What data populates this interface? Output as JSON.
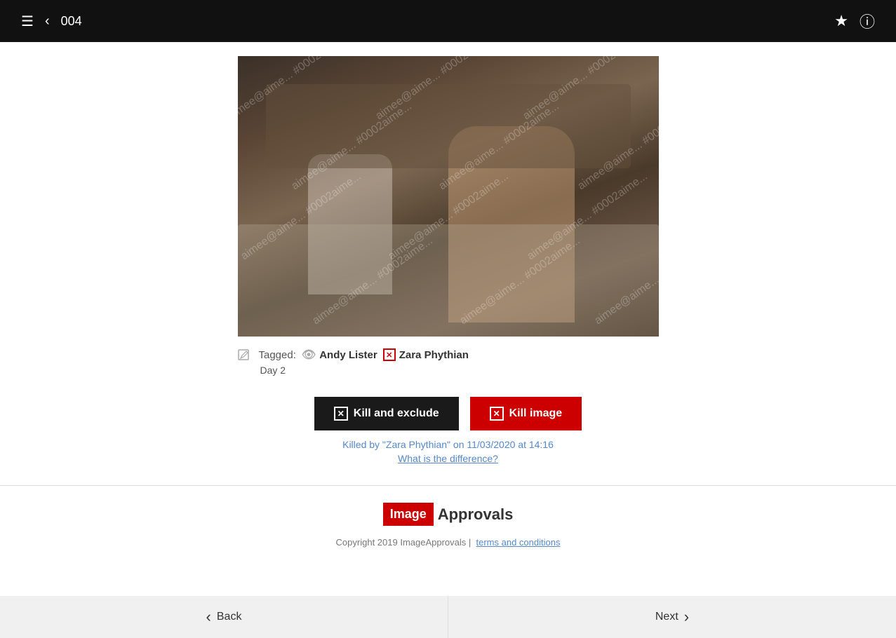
{
  "header": {
    "counter": "004",
    "back_label": "back",
    "star_label": "star",
    "info_label": "info"
  },
  "image": {
    "watermark": "aimee@aime... #0002aime..."
  },
  "tagged": {
    "label": "Tagged:",
    "persons": [
      {
        "name": "Andy Lister",
        "icon": "eye"
      },
      {
        "name": "Zara Phythian",
        "icon": "x-box"
      }
    ],
    "day": "Day 2"
  },
  "buttons": {
    "kill_exclude_label": "Kill and exclude",
    "kill_image_label": "Kill image"
  },
  "status": {
    "killed_by": "Killed by \"Zara Phythian\" on 11/03/2020 at 14:16",
    "what_diff": "What is the difference?"
  },
  "footer_logo": {
    "image_text": "Image",
    "approvals_text": "Approvals"
  },
  "copyright": {
    "text": "Copyright 2019 ImageApprovals  |",
    "terms_label": "terms and conditions"
  },
  "nav": {
    "back_label": "Back",
    "next_label": "Next"
  }
}
